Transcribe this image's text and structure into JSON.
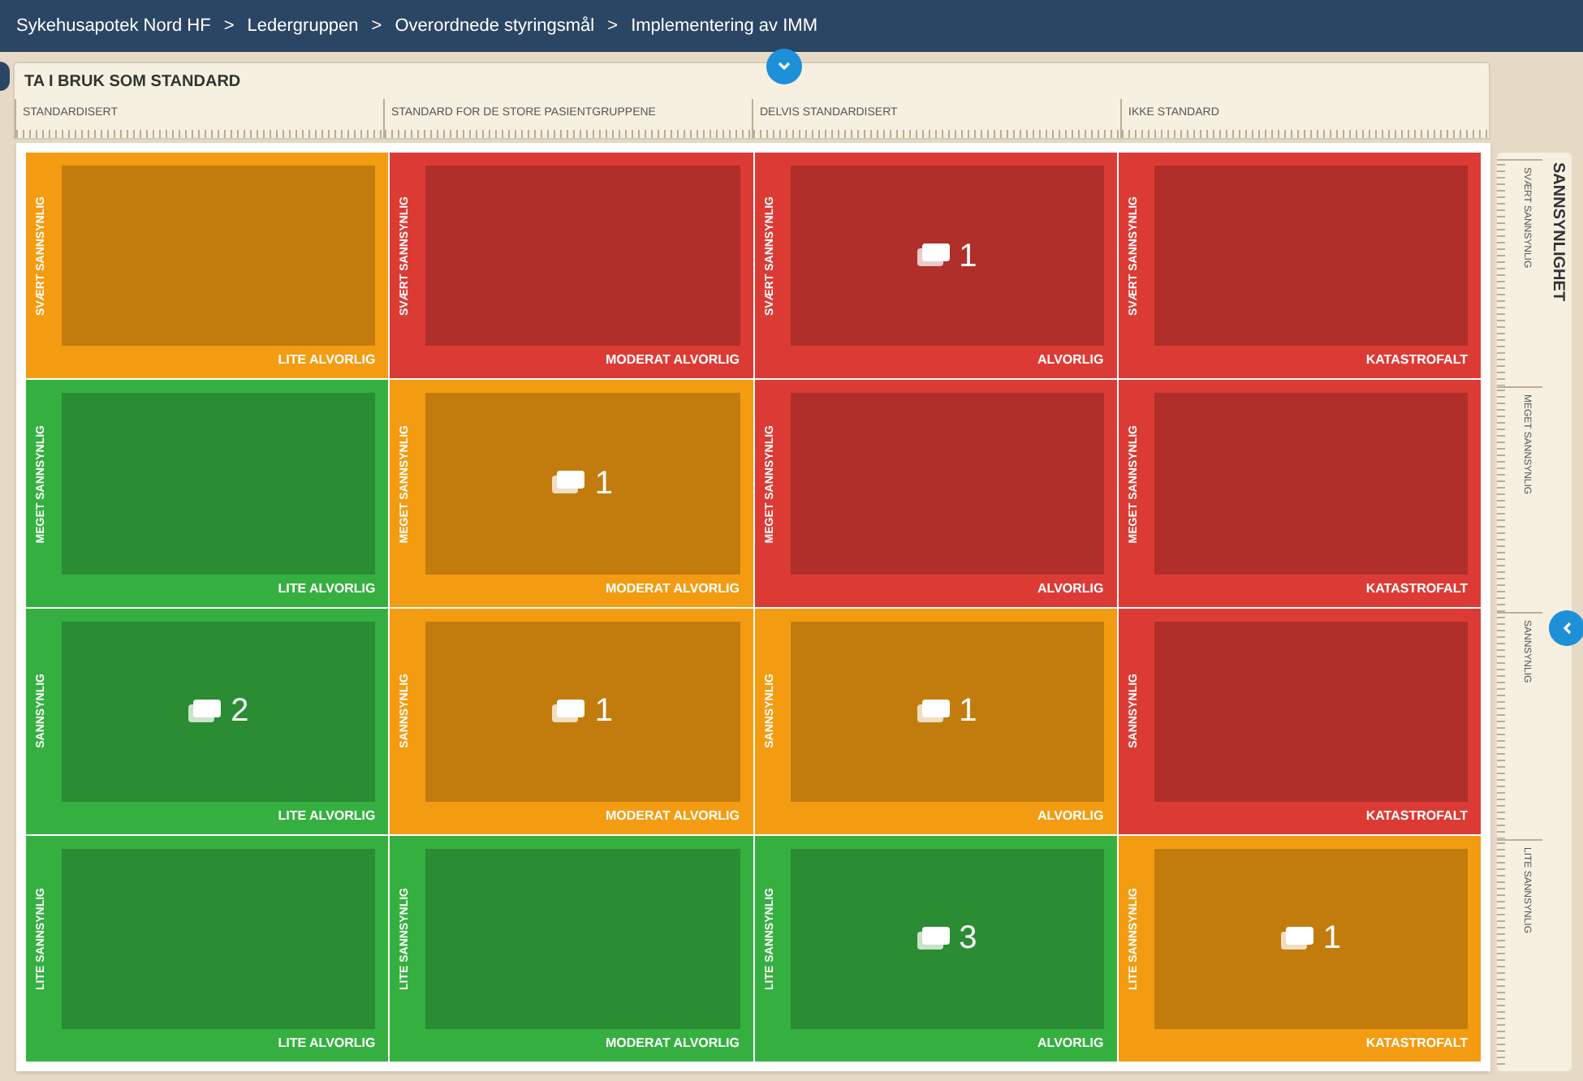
{
  "breadcrumb": [
    "Sykehusapotek Nord HF",
    "Ledergruppen",
    "Overordnede styringsmål",
    "Implementering av IMM"
  ],
  "breadcrumb_separator": ">",
  "matrix": {
    "title": "TA I BRUK SOM STANDARD",
    "columns": [
      "STANDARDISERT",
      "STANDARD FOR DE STORE PASIENTGRUPPENE",
      "DELVIS STANDARDISERT",
      "IKKE STANDARD"
    ],
    "axis_title": "SANNSYNLIGHET",
    "row_labels": [
      "SVÆRT SANNSYNLIG",
      "MEGET SANNSYNLIG",
      "SANNSYNLIG",
      "LITE SANNSYNLIG"
    ],
    "rows": [
      {
        "cells": [
          {
            "color": "#f39c12",
            "likelihood": "SVÆRT SANNSYNLIG",
            "severity": "LITE ALVORLIG"
          },
          {
            "color": "#dc3b35",
            "likelihood": "SVÆRT SANNSYNLIG",
            "severity": "MODERAT ALVORLIG"
          },
          {
            "color": "#dc3b35",
            "likelihood": "SVÆRT SANNSYNLIG",
            "severity": "ALVORLIG",
            "count": "1"
          },
          {
            "color": "#dc3b35",
            "likelihood": "SVÆRT SANNSYNLIG",
            "severity": "KATASTROFALT"
          }
        ]
      },
      {
        "cells": [
          {
            "color": "#35b040",
            "likelihood": "MEGET SANNSYNLIG",
            "severity": "LITE ALVORLIG"
          },
          {
            "color": "#f39c12",
            "likelihood": "MEGET SANNSYNLIG",
            "severity": "MODERAT ALVORLIG",
            "count": "1"
          },
          {
            "color": "#dc3b35",
            "likelihood": "MEGET SANNSYNLIG",
            "severity": "ALVORLIG"
          },
          {
            "color": "#dc3b35",
            "likelihood": "MEGET SANNSYNLIG",
            "severity": "KATASTROFALT"
          }
        ]
      },
      {
        "cells": [
          {
            "color": "#35b040",
            "likelihood": "SANNSYNLIG",
            "severity": "LITE ALVORLIG",
            "count": "2"
          },
          {
            "color": "#f39c12",
            "likelihood": "SANNSYNLIG",
            "severity": "MODERAT ALVORLIG",
            "count": "1"
          },
          {
            "color": "#f39c12",
            "likelihood": "SANNSYNLIG",
            "severity": "ALVORLIG",
            "count": "1"
          },
          {
            "color": "#dc3b35",
            "likelihood": "SANNSYNLIG",
            "severity": "KATASTROFALT"
          }
        ]
      },
      {
        "cells": [
          {
            "color": "#35b040",
            "likelihood": "LITE SANNSYNLIG",
            "severity": "LITE ALVORLIG"
          },
          {
            "color": "#35b040",
            "likelihood": "LITE SANNSYNLIG",
            "severity": "MODERAT ALVORLIG"
          },
          {
            "color": "#35b040",
            "likelihood": "LITE SANNSYNLIG",
            "severity": "ALVORLIG",
            "count": "3"
          },
          {
            "color": "#f39c12",
            "likelihood": "LITE SANNSYNLIG",
            "severity": "KATASTROFALT",
            "count": "1"
          }
        ]
      }
    ]
  }
}
